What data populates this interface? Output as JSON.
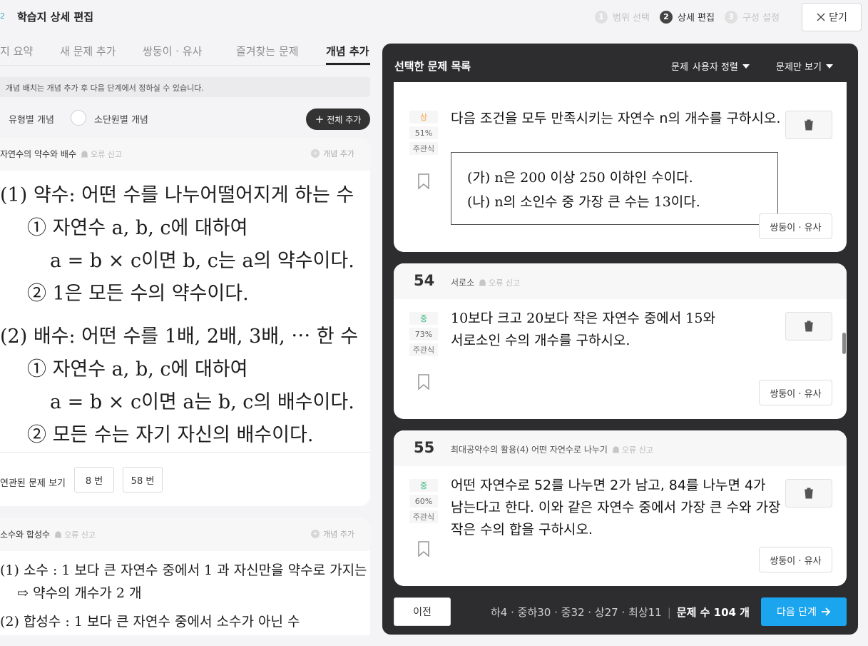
{
  "header": {
    "brand_num": "2",
    "title": "학습지 상세 편집",
    "steps": [
      {
        "num": "1",
        "label": "범위 선택"
      },
      {
        "num": "2",
        "label": "상세 편집"
      },
      {
        "num": "3",
        "label": "구성 설정"
      }
    ],
    "close_label": "닫기"
  },
  "tabs": [
    "지 요약",
    "새 문제 추가",
    "쌍둥이 · 유사",
    "즐겨찾는 문제",
    "개념 추가"
  ],
  "notice": "개념 배치는 개념 추가 후 다음 단계에서 정하실 수 있습니다.",
  "filters": {
    "option1": "유형별 개념",
    "option2": "소단원별 개념",
    "add_all": "전체 추가"
  },
  "concept1": {
    "title": "자연수의 약수와 배수",
    "report": "오류 신고",
    "add": "개념 추가",
    "lines": [
      "(1) 약수: 어떤 수를 나누어떨어지게 하는 수",
      "① 자연수 a, b, c에 대하여",
      "a = b × c이면 b, c는 a의 약수이다.",
      "② 1은 모든 수의 약수이다.",
      "(2) 배수: 어떤 수를 1배, 2배, 3배, ⋯ 한 수",
      "① 자연수 a, b, c에 대하여",
      "a = b × c이면 a는 b, c의 배수이다.",
      "② 모든 수는 자기 자신의 배수이다."
    ],
    "related_label": "연관된 문제 보기",
    "related": [
      "8 번",
      "58 번"
    ]
  },
  "concept2": {
    "title": "소수와 합성수",
    "report": "오류 신고",
    "add": "개념 추가",
    "lines": [
      "(1) 소수 : 1 보다 큰 자연수 중에서 1 과 자신만을 약수로 가지는 수",
      "⇨ 약수의 개수가 2 개",
      "(2) 합성수 : 1 보다 큰 자연수 중에서 소수가 아닌 수"
    ]
  },
  "panel": {
    "title": "선택한 문제 목록",
    "filter_label": "문제",
    "sort_label": "사용자 정렬",
    "view_label": "문제만 보기"
  },
  "questions": [
    {
      "level": "상",
      "level_color": "#f2a23a",
      "pct": "51%",
      "type": "주관식",
      "text": "다음 조건을 모두 만족시키는 자연수 n의 개수를 구하시오.",
      "cond1": "(가) n은 200 이상 250 이하인 수이다.",
      "cond2": "(나) n의 소인수 중 가장 큰 수는 13이다.",
      "similar": "쌍둥이 · 유사"
    },
    {
      "num": "54",
      "title": "서로소",
      "report": "오류 신고",
      "level": "중",
      "level_color": "#37b57e",
      "pct": "73%",
      "type": "주관식",
      "line1": "10보다 크고 20보다 작은 자연수 중에서 15와",
      "line2": "서로소인 수의 개수를 구하시오.",
      "similar": "쌍둥이 · 유사"
    },
    {
      "num": "55",
      "title": "최대공약수의 활용(4) 어떤 자연수로 나누기",
      "report": "오류 신고",
      "level": "중",
      "level_color": "#37b57e",
      "pct": "60%",
      "type": "주관식",
      "line1": "어떤 자연수로 52를 나누면 2가 남고, 84를 나누면 4가",
      "line2": "남는다고 한다. 이와 같은 자연수 중에서 가장 큰 수와 가장",
      "line3": "작은 수의 합을 구하시오.",
      "similar": "쌍둥이 · 유사"
    }
  ],
  "footer": {
    "prev": "이전",
    "stats": "하4 · 중하30 · 중32 · 상27 · 최상11",
    "sep": "|",
    "total": "문제 수 104 개",
    "next": "다음 단계"
  }
}
